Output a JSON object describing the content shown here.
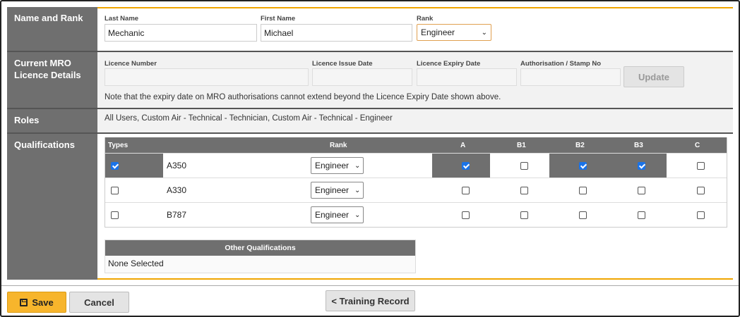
{
  "sections": {
    "name_rank": "Name and Rank",
    "licence": "Current MRO Licence Details",
    "roles": "Roles",
    "qualifications": "Qualifications"
  },
  "name_rank": {
    "last_name_label": "Last Name",
    "last_name_value": "Mechanic",
    "first_name_label": "First Name",
    "first_name_value": "Michael",
    "rank_label": "Rank",
    "rank_value": "Engineer"
  },
  "licence": {
    "number_label": "Licence Number",
    "issue_label": "Licence Issue Date",
    "expiry_label": "Licence Expiry Date",
    "stamp_label": "Authorisation / Stamp No",
    "update_label": "Update",
    "note": "Note that the expiry date on MRO authorisations cannot extend beyond the Licence Expiry Date shown above."
  },
  "roles": {
    "text": "All Users, Custom Air - Technical - Technician, Custom Air - Technical - Engineer"
  },
  "qualifications": {
    "headers": {
      "types": "Types",
      "rank": "Rank",
      "a": "A",
      "b1": "B1",
      "b2": "B2",
      "b3": "B3",
      "c": "C"
    },
    "rows": [
      {
        "type": "A350",
        "selected": true,
        "rank": "Engineer",
        "a": true,
        "b1": false,
        "b2": true,
        "b3": true,
        "c": false
      },
      {
        "type": "A330",
        "selected": false,
        "rank": "Engineer",
        "a": false,
        "b1": false,
        "b2": false,
        "b3": false,
        "c": false
      },
      {
        "type": "B787",
        "selected": false,
        "rank": "Engineer",
        "a": false,
        "b1": false,
        "b2": false,
        "b3": false,
        "c": false
      }
    ],
    "other_header": "Other Qualifications",
    "other_value": "None Selected"
  },
  "footer": {
    "save_label": "Save",
    "cancel_label": "Cancel",
    "training_label": "< Training Record"
  },
  "colors": {
    "accent": "#f0a500",
    "header_grey": "#6f6f6f",
    "checkbox_blue": "#1a73e8"
  },
  "icons": {
    "save": "floppy-disk-icon",
    "select": "chevron-down-icon"
  }
}
